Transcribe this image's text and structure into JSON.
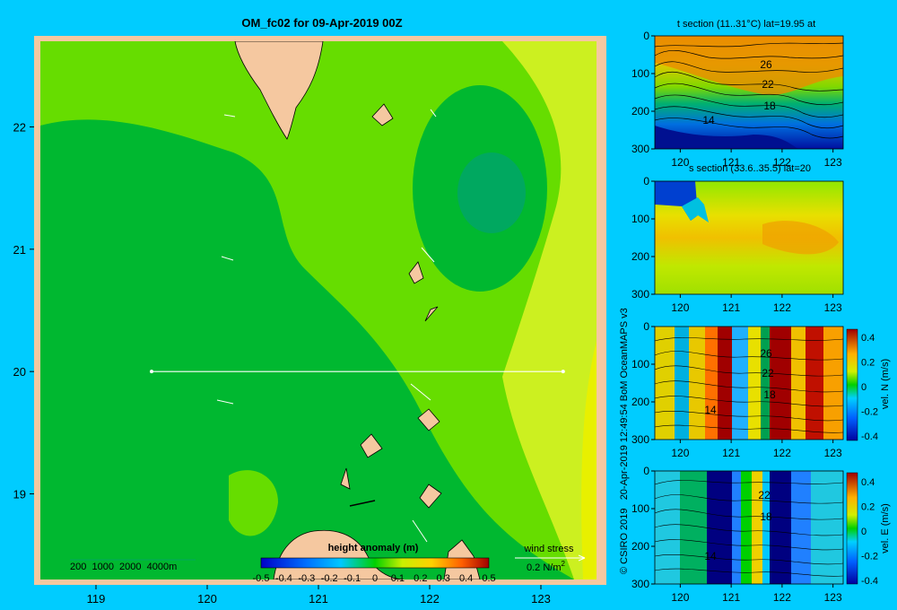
{
  "main_map": {
    "title": "OM_fc02 for 09-Apr-2019 00Z",
    "x_ticks": [
      "119",
      "120",
      "121",
      "122",
      "123"
    ],
    "y_ticks": [
      "22",
      "21",
      "20",
      "19"
    ],
    "depth_legend": "200  1000  2000  4000m",
    "colorbar_title": "height anomaly (m)",
    "colorbar_ticks": [
      "-0.5",
      "-0.4",
      "-0.3",
      "-0.2",
      "-0.1",
      "0",
      "0.1",
      "0.2",
      "0.3",
      "0.4",
      "0.5"
    ],
    "wind_stress_label": "wind stress",
    "wind_stress_scale": "0.2 N/m",
    "wind_stress_exp": "2",
    "section_line": {
      "lat": 20,
      "lon_start": 119.5,
      "lon_end": 123.2
    },
    "x_range": [
      118.5,
      123.5
    ],
    "y_range": [
      18.3,
      22.7
    ],
    "colors": {
      "land": "#f5c8a0",
      "border": "#f5c8a0",
      "high": "#ccf020",
      "mid": "#66dd00",
      "low": "#00b830",
      "lowest": "#00a860"
    }
  },
  "side_panels": [
    {
      "title": "t section (11..31°C) lat=19.95 at",
      "type": "temperature",
      "x_ticks": [
        "120",
        "121",
        "122",
        "123"
      ],
      "y_ticks": [
        "0",
        "100",
        "200",
        "300"
      ],
      "contour_labels": [
        "26",
        "22",
        "18",
        "14"
      ],
      "colorbar": null
    },
    {
      "title": "s section (33.6..35.5) lat=20",
      "type": "salinity",
      "x_ticks": [
        "120",
        "121",
        "122",
        "123"
      ],
      "y_ticks": [
        "0",
        "100",
        "200",
        "300"
      ],
      "contour_labels": [],
      "colorbar": null
    },
    {
      "title": "",
      "type": "velocity_north",
      "x_ticks": [
        "120",
        "121",
        "122",
        "123"
      ],
      "y_ticks": [
        "0",
        "100",
        "200",
        "300"
      ],
      "contour_labels": [
        "26",
        "22",
        "18",
        "14"
      ],
      "colorbar": {
        "label": "vel. N (m/s)",
        "ticks": [
          "0.4",
          "0.2",
          "0",
          "-0.2",
          "-0.4"
        ]
      }
    },
    {
      "title": "",
      "type": "velocity_east",
      "x_ticks": [
        "120",
        "121",
        "122",
        "123"
      ],
      "y_ticks": [
        "0",
        "100",
        "200",
        "300"
      ],
      "contour_labels": [
        "22",
        "18",
        "14"
      ],
      "colorbar": {
        "label": "vel. E (m/s)",
        "ticks": [
          "0.4",
          "0.2",
          "0",
          "-0.2",
          "-0.4"
        ]
      }
    }
  ],
  "credit": "© CSIRO 2019   20-Apr-2019 12:49:54 BoM OceanMAPS v3",
  "chart_data": [
    {
      "type": "heatmap",
      "title": "OM_fc02 for 09-Apr-2019 00Z",
      "xlabel": "",
      "ylabel": "",
      "xlim": [
        118.5,
        123.5
      ],
      "ylim": [
        18.3,
        22.7
      ],
      "x_ticks": [
        119,
        120,
        121,
        122,
        123
      ],
      "y_ticks": [
        19,
        20,
        21,
        22
      ],
      "colorbar": {
        "label": "height anomaly (m)",
        "range": [
          -0.5,
          0.5
        ]
      }
    },
    {
      "type": "heatmap",
      "title": "t section (11..31°C) lat=19.95 at",
      "xlim": [
        119.5,
        123.2
      ],
      "ylim": [
        300,
        0
      ],
      "contour_labels": [
        26,
        22,
        18,
        14
      ]
    },
    {
      "type": "heatmap",
      "title": "s section (33.6..35.5) lat=20",
      "xlim": [
        119.5,
        123.2
      ],
      "ylim": [
        300,
        0
      ]
    },
    {
      "type": "heatmap",
      "title": "",
      "xlim": [
        119.5,
        123.2
      ],
      "ylim": [
        300,
        0
      ],
      "colorbar": {
        "label": "vel. N (m/s)",
        "range": [
          -0.4,
          0.4
        ]
      }
    },
    {
      "type": "heatmap",
      "title": "",
      "xlim": [
        119.5,
        123.2
      ],
      "ylim": [
        300,
        0
      ],
      "colorbar": {
        "label": "vel. E (m/s)",
        "range": [
          -0.4,
          0.4
        ]
      }
    }
  ]
}
